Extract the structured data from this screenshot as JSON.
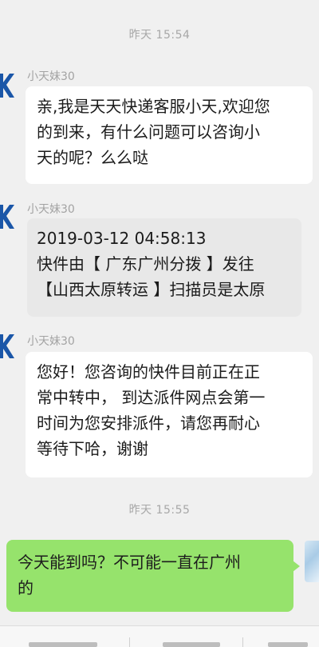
{
  "messages": [
    {
      "type": "time",
      "text": "昨天 15:54"
    },
    {
      "type": "incoming",
      "sender": "小天妹30",
      "avatar_icon": "kuaidi-logo-icon",
      "text": "亲,我是天天快递客服小天,欢迎您\n的到来，有什么问题可以咨询小\n天的呢？么么哒"
    },
    {
      "type": "incoming",
      "sender": "小天妹30",
      "avatar_icon": "kuaidi-logo-icon",
      "text": "2019-03-12 04:58:13\n快件由【 广东广州分拨 】发往\n【山西太原转运 】扫描员是太原"
    },
    {
      "type": "incoming",
      "sender": "小天妹30",
      "avatar_icon": "kuaidi-logo-icon",
      "text": "您好！您咨询的快件目前正在正\n常中转中， 到达派件网点会第一\n时间为您安排派件，请您再耐心\n等待下哈，谢谢"
    },
    {
      "type": "time",
      "text": "昨天 15:55"
    },
    {
      "type": "outgoing",
      "text": "今天能到吗？不可能一直在广州\n的"
    }
  ],
  "colors": {
    "background": "#f0f0f0",
    "incoming_bubble": "#ffffff",
    "tracking_bubble": "#e8e8e8",
    "outgoing_bubble": "#96e36c",
    "logo_blue": "#1a56a8"
  }
}
